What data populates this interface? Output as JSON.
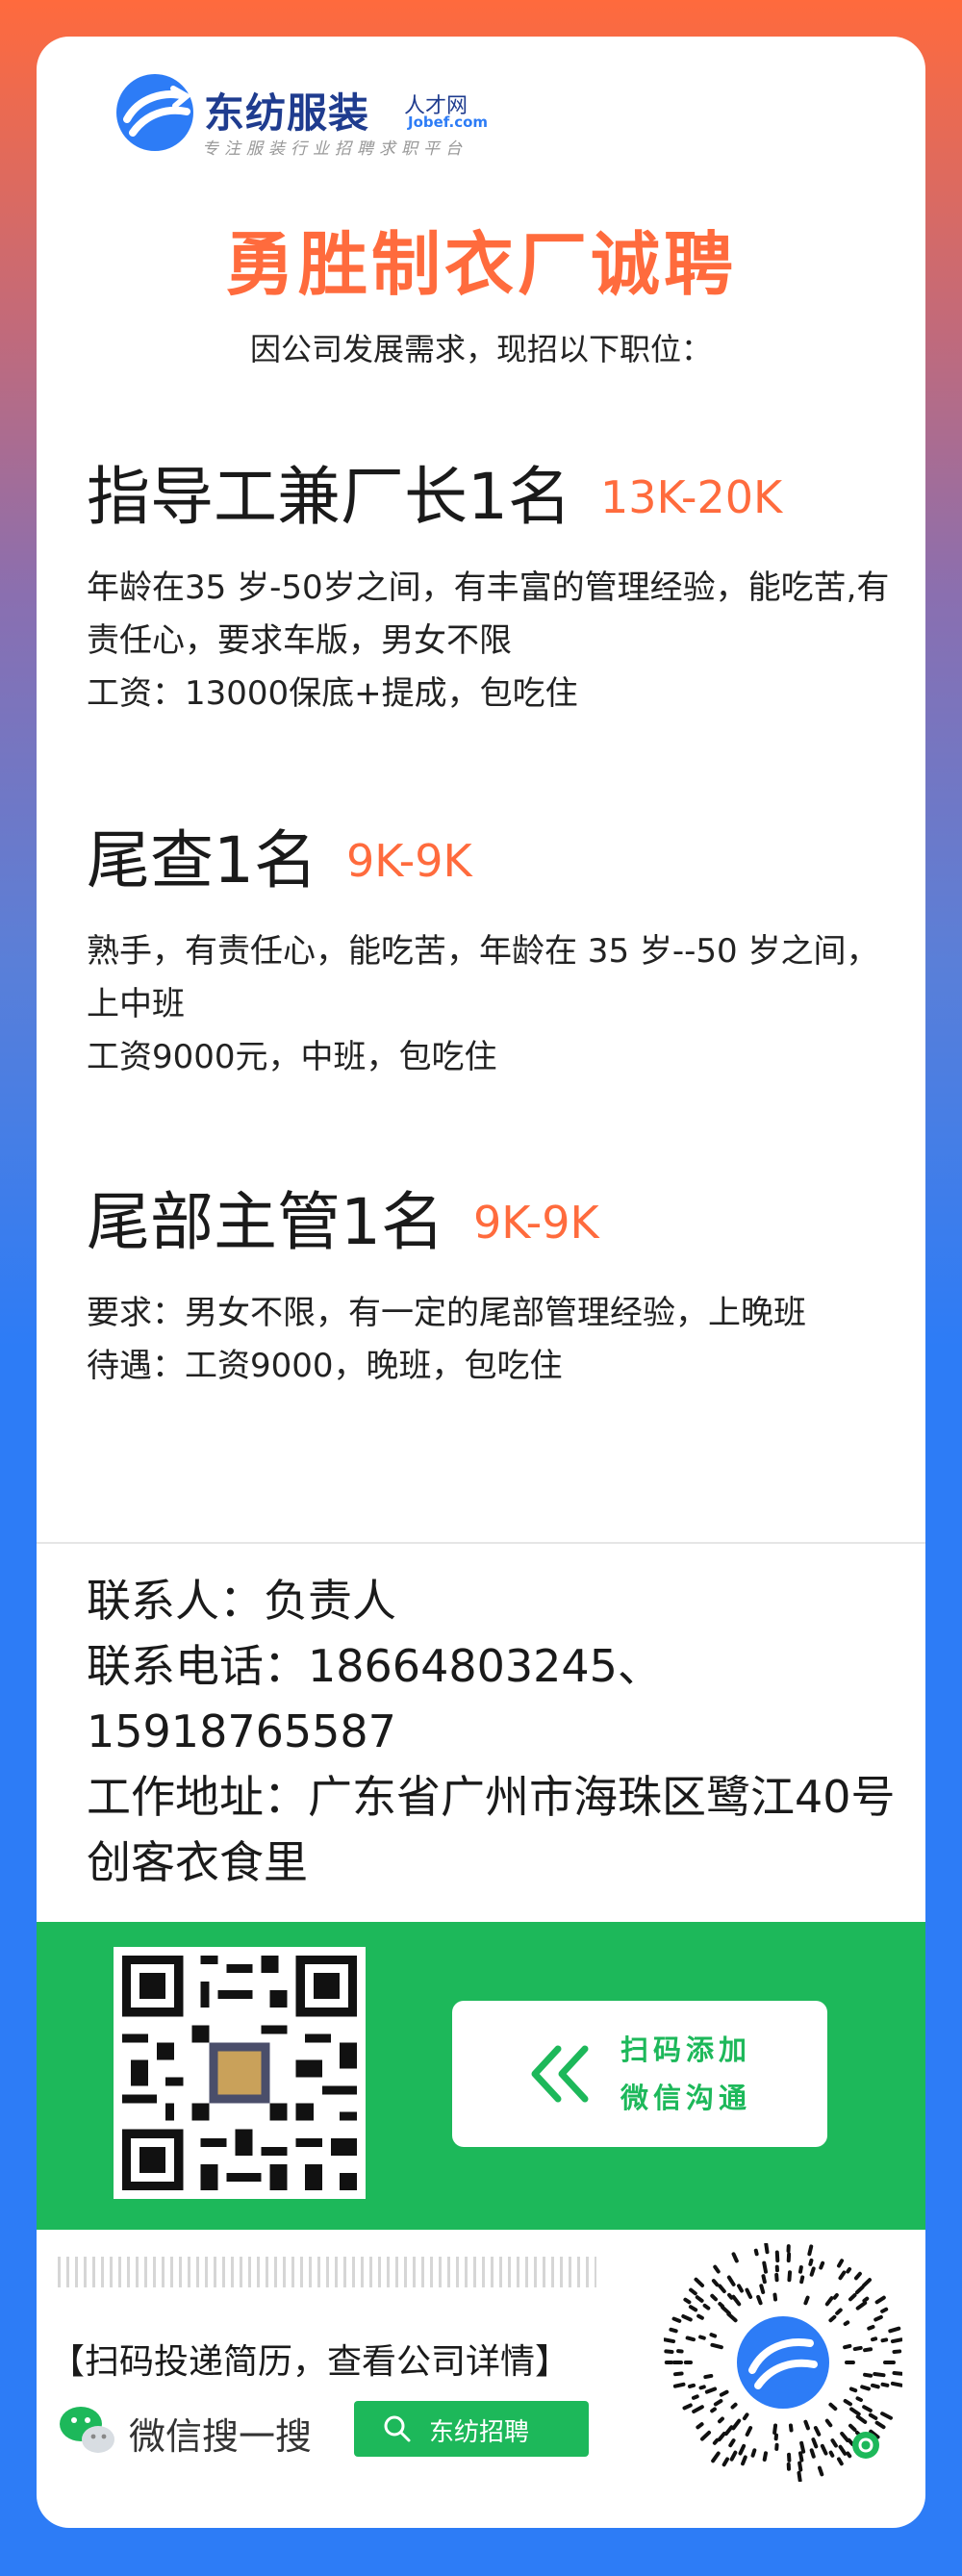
{
  "logo": {
    "name": "东纺服装",
    "talent": "人才网",
    "domain": "Jobef.com",
    "slogan": "专注服装行业招聘求职平台"
  },
  "headline": "勇胜制衣厂诚聘",
  "subline": "因公司发展需求，现招以下职位：",
  "jobs": [
    {
      "title": "指导工兼厂长1名",
      "salary": "13K-20K",
      "lines": [
        "年龄在35 岁-50岁之间，有丰富的管理经验，能吃苦,有责任心，要求车版，男女不限",
        "工资：13000保底+提成，包吃住"
      ]
    },
    {
      "title": "尾查1名",
      "salary": "9K-9K",
      "lines": [
        "熟手，有责任心，能吃苦，年龄在 35 岁--50 岁之间，上中班",
        "工资9000元，中班，包吃住"
      ]
    },
    {
      "title": "尾部主管1名",
      "salary": "9K-9K",
      "lines": [
        "要求：男女不限，有一定的尾部管理经验，上晚班",
        "待遇：工资9000，晚班，包吃住"
      ]
    }
  ],
  "contact": {
    "person": "联系人：负责人",
    "phone": "联系电话：18664803245、15918765587",
    "address": "工作地址：广东省广州市海珠区鹭江40号创客衣食里"
  },
  "wechat_add": {
    "line1": "扫码添加",
    "line2": "微信沟通"
  },
  "bottom": {
    "scan_text": "【扫码投递简历，查看公司详情】",
    "wechat_search_label": "微信搜一搜",
    "search_query": "东纺招聘"
  },
  "colors": {
    "accent": "#ff6b3d",
    "green": "#1db85a",
    "brand_blue": "#2d7cf6"
  }
}
